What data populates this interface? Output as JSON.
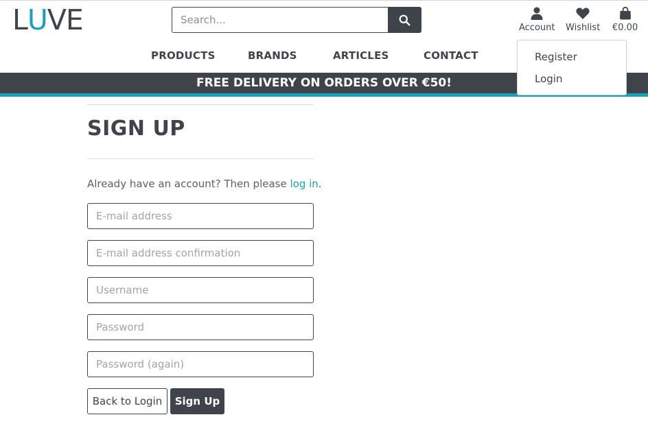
{
  "header": {
    "logo": {
      "part1": "L",
      "part2": "U",
      "part3": "VE"
    },
    "search": {
      "placeholder": "Search..."
    },
    "account_label": "Account",
    "wishlist_label": "Wishlist",
    "cart_total": "€0.00"
  },
  "nav": {
    "items": [
      {
        "label": "PRODUCTS"
      },
      {
        "label": "BRANDS"
      },
      {
        "label": "ARTICLES"
      },
      {
        "label": "CONTACT"
      }
    ]
  },
  "banner": {
    "text": "FREE DELIVERY ON ORDERS OVER €50!"
  },
  "account_menu": {
    "items": [
      {
        "label": "Register"
      },
      {
        "label": "Login"
      }
    ]
  },
  "signup": {
    "title": "SIGN UP",
    "intro_prefix": "Already have an account? Then please ",
    "intro_link": "log in",
    "intro_suffix": ".",
    "fields": {
      "email": {
        "placeholder": "E-mail address"
      },
      "email_confirm": {
        "placeholder": "E-mail address confirmation"
      },
      "username": {
        "placeholder": "Username"
      },
      "password": {
        "placeholder": "Password"
      },
      "password_again": {
        "placeholder": "Password (again)"
      }
    },
    "back_button": "Back to Login",
    "submit_button": "Sign Up"
  },
  "colors": {
    "primary_dark": "#3f444b",
    "accent_teal": "#17a2b8"
  },
  "icons": {
    "search": "search-icon",
    "account": "user-icon",
    "wishlist": "heart-icon",
    "cart": "shopping-bag-icon"
  }
}
